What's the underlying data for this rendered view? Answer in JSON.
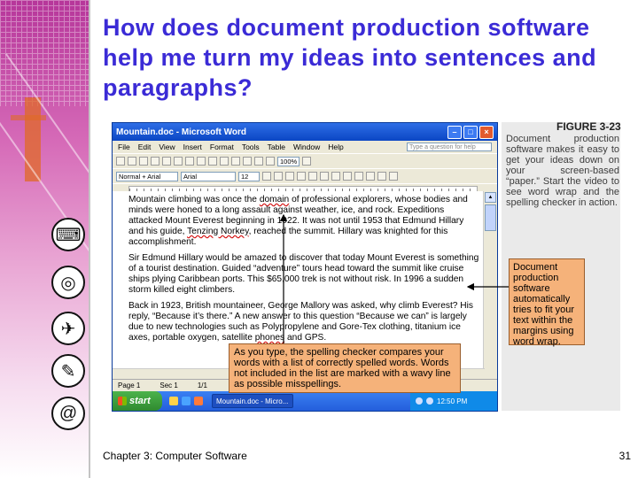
{
  "slide": {
    "title": "How does document production software help me turn my ideas into sentences and paragraphs?",
    "footer": "Chapter 3: Computer Software",
    "page_number": "31"
  },
  "sidebar_icons": [
    "keyboard-icon",
    "disc-icon",
    "airplane-icon",
    "pen-icon",
    "at-sign-icon"
  ],
  "word_window": {
    "title": "Mountain.doc - Microsoft Word",
    "menu": [
      "File",
      "Edit",
      "View",
      "Insert",
      "Format",
      "Tools",
      "Table",
      "Window",
      "Help"
    ],
    "ask_placeholder": "Type a question for help",
    "style_value": "Normal + Arial",
    "font_value": "Arial",
    "size_value": "12",
    "zoom_value": "100%",
    "paragraphs": [
      [
        "Mountain climbing was once the ",
        "domain",
        " of professional explorers, whose bodies and minds were honed to a long assault against weather, ice, and rock. Expeditions attacked Mount Everest beginning in 1922. It was not until 1953 that Edmund Hillary and his guide, ",
        "Tenzing Norkey",
        ", reached the summit. Hillary was knighted for this accomplishment."
      ],
      [
        "Sir Edmund Hillary would be amazed to discover that today Mount Everest is something of a tourist destination. Guided “adventure” tours head toward the summit like cruise ships plying Caribbean ports. This $65,000 trek is not without risk. In 1996 a sudden storm killed eight climbers."
      ],
      [
        "Back in 1923, British mountaineer, George Mallory was asked, why climb Everest? His reply, “Because it’s there.” A new answer to this question “Because we can” is largely due to new technologies such as Polypropylene and Gore-Tex clothing, titanium ice axes, portable oxygen, satellite ",
        "phones",
        " and GPS."
      ]
    ],
    "status": {
      "page": "Page 1",
      "sec": "Sec 1",
      "pages": "1/1"
    },
    "taskbar": {
      "start": "start",
      "item": "Mountain.doc - Micro...",
      "clock": "12:50 PM"
    }
  },
  "figure": {
    "number": "FIGURE 3-23",
    "caption": "Document production software makes it easy to get your ideas down on your screen-based “paper.” Start the video to see word wrap and the spelling checker in action.",
    "callout_wordwrap": "Document production software automatically tries to fit your text within the margins using word wrap.",
    "callout_spelling": "As you type, the spelling checker compares your words with a list of correctly spelled words. Words not included in the list are marked with a wavy line as possible misspellings."
  },
  "colors": {
    "title": "#3b2bd6",
    "callout": "#f5b27a",
    "sidebar": "#b6369a"
  }
}
